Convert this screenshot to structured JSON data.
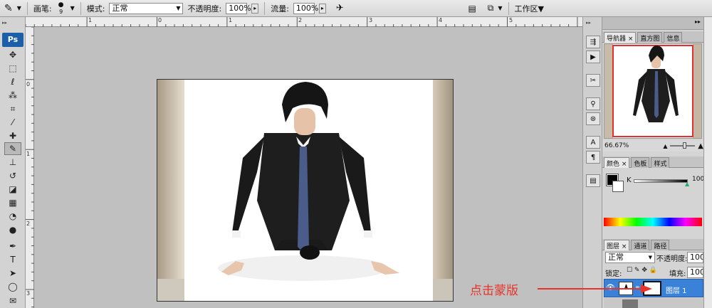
{
  "options_bar": {
    "brush_label": "画笔:",
    "brush_size": "9",
    "mode_label": "模式:",
    "mode_value": "正常",
    "opacity_label": "不透明度:",
    "opacity_value": "100%",
    "flow_label": "流量:",
    "flow_value": "100%",
    "workspace_label": "工作区▼"
  },
  "toolbar": {
    "logo": "Ps"
  },
  "rulers": {
    "top_labels": [
      "1",
      "0",
      "1",
      "2",
      "3",
      "4",
      "5"
    ],
    "left_labels": [
      "0",
      "1",
      "2",
      "3"
    ]
  },
  "navigator": {
    "tabs": [
      "导航器",
      "直方图",
      "信息"
    ],
    "zoom": "66.67%"
  },
  "color_panel": {
    "tabs": [
      "颜色",
      "色板",
      "样式"
    ],
    "channel_label": "K",
    "channel_value": "100"
  },
  "layers_panel": {
    "tabs": [
      "图层",
      "通道",
      "路径"
    ],
    "blend_mode": "正常",
    "opacity_label": "不透明度:",
    "opacity_value": "100%",
    "lock_label": "锁定:",
    "fill_label": "填充:",
    "fill_value": "100%",
    "layer_name": "图层 1"
  },
  "annotation": {
    "text": "点击蒙版",
    "color": "#e8332a"
  },
  "colors": {
    "selection_blue": "#3a82d8",
    "nav_box_red": "#e03030",
    "ps_blue": "#1c5fa8"
  }
}
